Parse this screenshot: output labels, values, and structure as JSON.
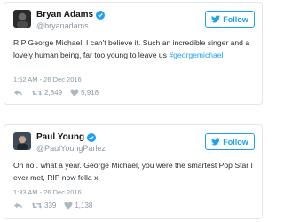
{
  "tweets": [
    {
      "name": "Bryan Adams",
      "handle": "@bryanadams",
      "follow_label": "Follow",
      "text": "RIP George Michael. I can't believe it. Such an incredible singer and a lovely human being, far too young to leave us",
      "hashtag": "#georgemichael",
      "time": "1:52 AM - 26 Dec 2016",
      "retweets": "2,849",
      "likes": "5,918"
    },
    {
      "name": "Paul Young",
      "handle": "@PaulYoungParlez",
      "follow_label": "Follow",
      "text": "Oh no.. what a year. George Michael, you were the smartest Pop Star I ever met, RIP now fella x",
      "time": "1:33 AM - 26 Dec 2016",
      "retweets": "339",
      "likes": "1,138"
    }
  ],
  "icons": {
    "verified": "verified-badge-icon",
    "follow": "twitter-bird-icon",
    "reply": "reply-icon",
    "retweet": "retweet-icon",
    "like": "heart-icon"
  },
  "colors": {
    "accent": "#1da1f2",
    "muted": "#8899a6",
    "border": "#e1e8ed"
  }
}
